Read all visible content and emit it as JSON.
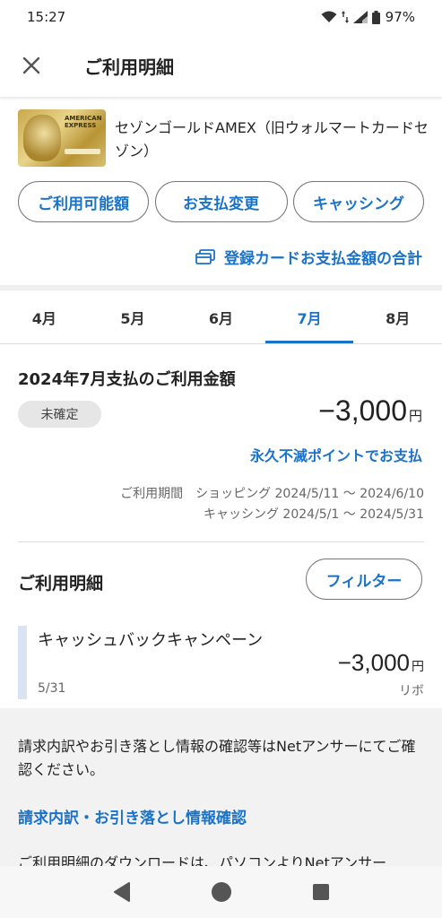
{
  "status": {
    "time": "15:27",
    "battery": "97%"
  },
  "header": {
    "close_icon": "close-icon",
    "title": "ご利用明細"
  },
  "card": {
    "name": "セゾンゴールドAMEX（旧ウォルマートカードセゾン）"
  },
  "actions": {
    "available": "ご利用可能額",
    "payment_change": "お支払変更",
    "cashing": "キャッシング"
  },
  "total_link": "登録カードお支払金額の合計",
  "tabs": [
    "4月",
    "5月",
    "6月",
    "7月",
    "8月"
  ],
  "active_tab": "7月",
  "summary": {
    "title": "2024年7月支払のご利用金額",
    "badge": "未確定",
    "amount": "−3,000",
    "yen": "円",
    "point_link": "永久不滅ポイントでお支払",
    "period_line1": "ご利用期間　ショッピング 2024/5/11 〜 2024/6/10",
    "period_line2": "キャッシング 2024/5/1 〜 2024/5/31"
  },
  "details": {
    "title": "ご利用明細",
    "filter": "フィルター",
    "items": [
      {
        "name": "キャッシュバックキャンペーン",
        "date": "5/31",
        "amount": "−3,000",
        "yen": "円",
        "kind": "リボ"
      }
    ]
  },
  "info": {
    "text": "請求内訳やお引き落とし情報の確認等はNetアンサーにてご確認ください。",
    "link": "請求内訳・お引き落とし情報確認",
    "cut_text": "ご利用明細のダウンロードは、パソコンよりNetアンサー"
  },
  "colors": {
    "accent": "#1a73c8",
    "divider": "#eeeeee",
    "panel": "#f2f2f2"
  }
}
